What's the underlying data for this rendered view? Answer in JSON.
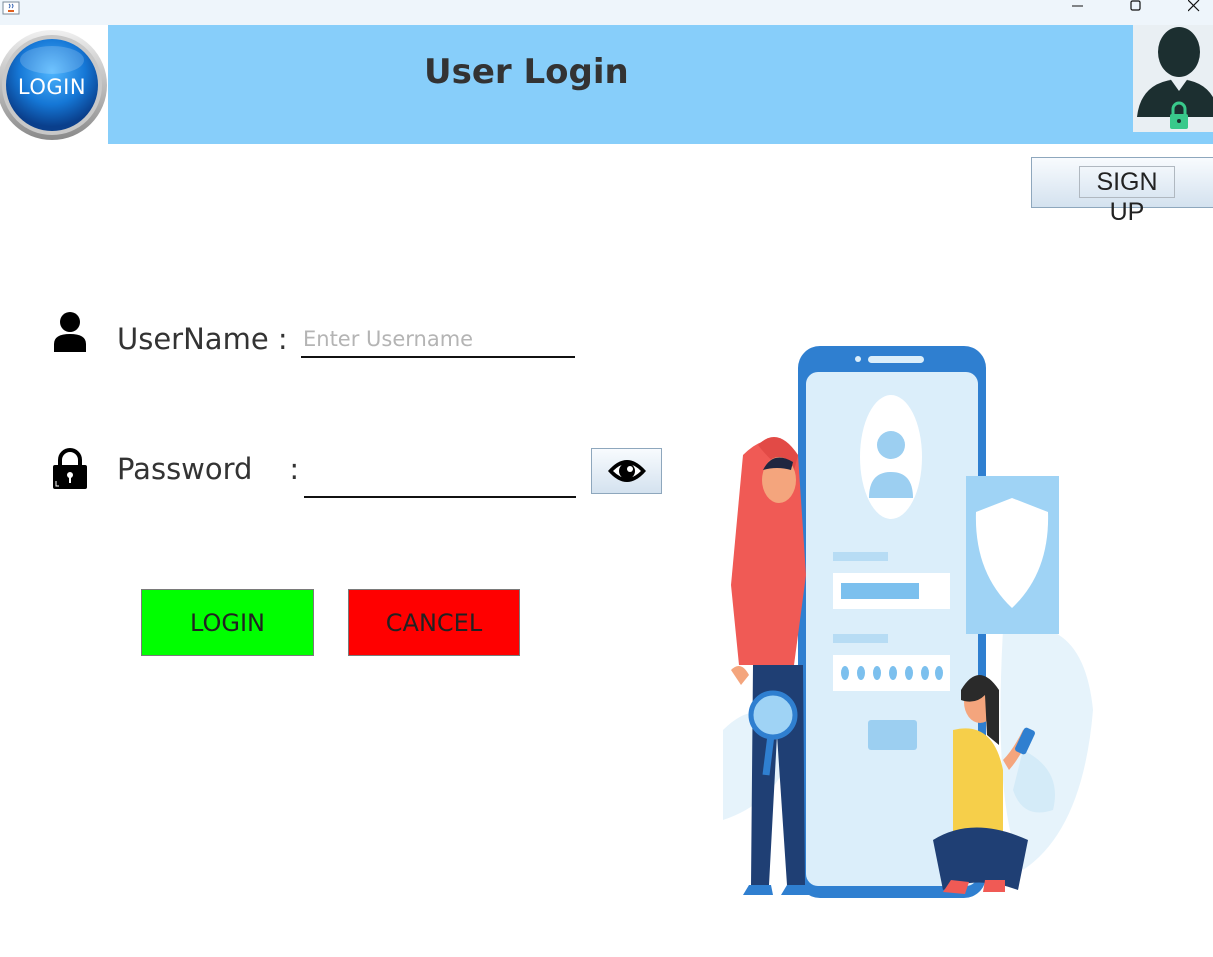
{
  "window": {
    "app_icon": "java-cup-icon",
    "controls": [
      "minimize-icon",
      "maximize-icon",
      "close-icon"
    ]
  },
  "header": {
    "logo_text": "LOGIN",
    "title": "User Login",
    "avatar_icon": "user-lock-icon",
    "band_color": "#87cefa"
  },
  "signup": {
    "label": "SIGN UP"
  },
  "form": {
    "username": {
      "icon": "user-icon",
      "label": "UserName :",
      "value": "",
      "placeholder": "Enter Username"
    },
    "password": {
      "icon": "lock-icon",
      "label": "Password    :",
      "value": "",
      "placeholder": ""
    },
    "toggle_visibility_icon": "eye-icon"
  },
  "actions": {
    "login_label": "LOGIN",
    "login_color": "#00ff00",
    "cancel_label": "CANCEL",
    "cancel_color": "#ff0000"
  },
  "illustration": {
    "icon": "phone-login-illustration"
  }
}
